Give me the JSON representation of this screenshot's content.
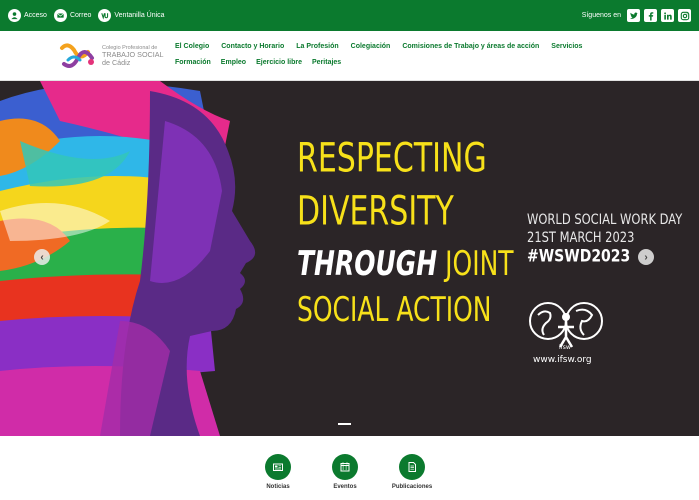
{
  "topbar": {
    "links": [
      {
        "label": "Acceso",
        "icon": "user-icon"
      },
      {
        "label": "Correo",
        "icon": "mail-icon"
      },
      {
        "label": "Ventanilla Única",
        "icon": "vu-icon"
      }
    ],
    "follow_text": "Síguenos en",
    "social": [
      "twitter-icon",
      "facebook-icon",
      "linkedin-icon",
      "instagram-icon"
    ],
    "colors": {
      "brand_green": "#0b7a2e"
    }
  },
  "header": {
    "logo": {
      "line1": "Colegio Profesional de",
      "line2": "TRABAJO SOCIAL",
      "line3": "de Cádiz"
    },
    "nav_row1": [
      "El Colegio",
      "Contacto y Horario",
      "La Profesión",
      "Colegiación",
      "Comisiones de Trabajo y áreas de acción",
      "Servicios"
    ],
    "nav_row2": [
      "Formación",
      "Empleo",
      "Ejercicio libre",
      "Peritajes"
    ]
  },
  "hero": {
    "headline_1": "RESPECTING",
    "headline_2": "DIVERSITY",
    "headline_3a": "THROUGH",
    "headline_3b": " JOINT",
    "headline_4": "SOCIAL ACTION",
    "event_1": "WORLD SOCIAL WORK DAY",
    "event_2": "21ST MARCH 2023",
    "event_3": "#WSWD2023",
    "ifsw_label": "ifsw",
    "url": "www.ifsw.org"
  },
  "quick_links": [
    {
      "label": "Noticias",
      "icon": "news-icon"
    },
    {
      "label": "Eventos",
      "icon": "calendar-icon"
    },
    {
      "label": "Publicaciones",
      "icon": "document-icon"
    }
  ]
}
